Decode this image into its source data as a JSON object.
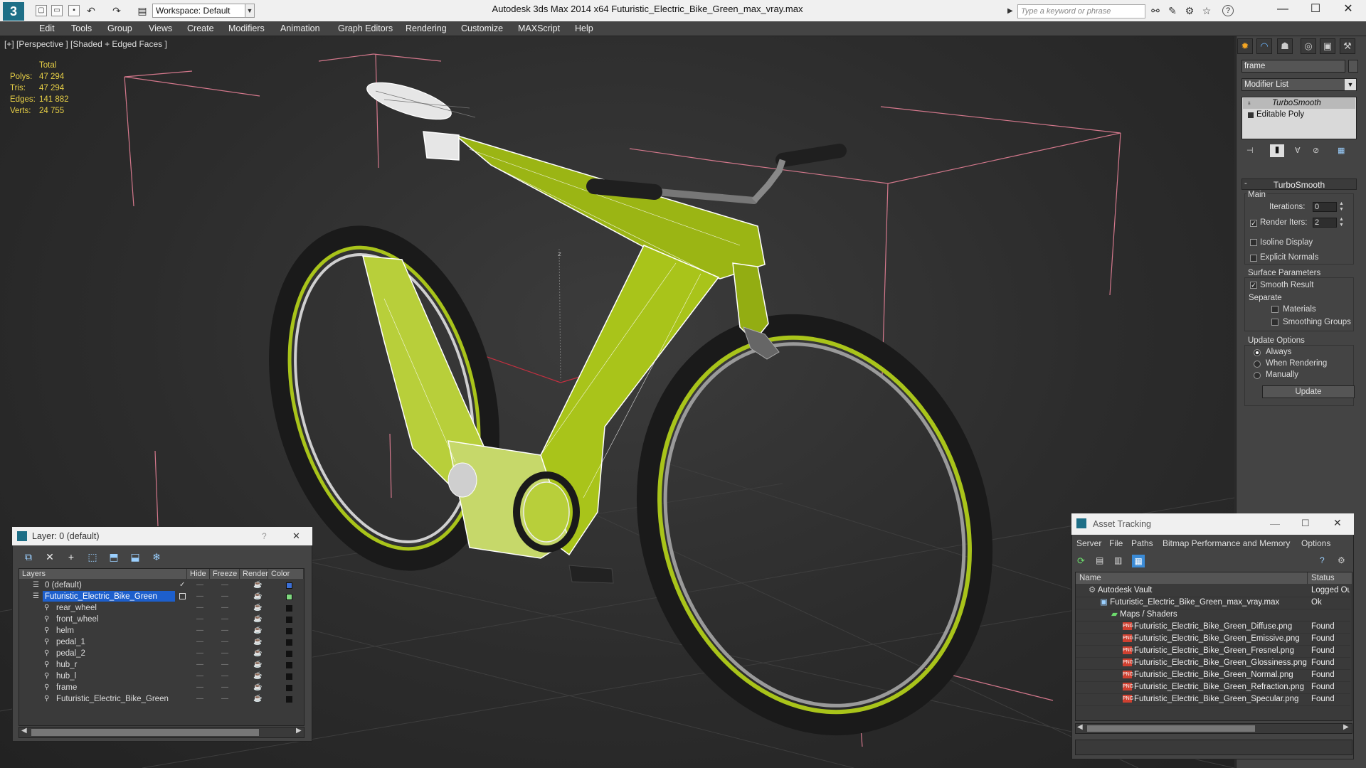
{
  "app": {
    "logo": "3",
    "workspace": "Workspace: Default",
    "title": "Autodesk 3ds Max  2014 x64        Futuristic_Electric_Bike_Green_max_vray.max",
    "search_placeholder": "Type a keyword or phrase"
  },
  "menus": [
    "Edit",
    "Tools",
    "Group",
    "Views",
    "Create",
    "Modifiers",
    "Animation",
    "Graph Editors",
    "Rendering",
    "Customize",
    "MAXScript",
    "Help"
  ],
  "viewport": {
    "label": "[+] [Perspective ] [Shaded + Edged Faces ]",
    "axis_label": "z",
    "stats": {
      "header": "Total",
      "rows": [
        {
          "label": "Polys:",
          "value": "47 294"
        },
        {
          "label": "Tris:",
          "value": "47 294"
        },
        {
          "label": "Edges:",
          "value": "141 882"
        },
        {
          "label": "Verts:",
          "value": "24 755"
        }
      ]
    }
  },
  "command_panel": {
    "object_name": "frame",
    "modifier_list": "Modifier List",
    "stack": [
      "TurboSmooth",
      "Editable Poly"
    ],
    "rollout_title": "TurboSmooth",
    "main_label": "Main",
    "iterations_label": "Iterations:",
    "iterations_value": "0",
    "render_iters_label": "Render Iters:",
    "render_iters_value": "2",
    "isoline_label": "Isoline Display",
    "explicit_normals_label": "Explicit Normals",
    "surface_params_label": "Surface Parameters",
    "smooth_result_label": "Smooth Result",
    "separate_label": "Separate",
    "materials_label": "Materials",
    "smoothing_groups_label": "Smoothing Groups",
    "update_options_label": "Update Options",
    "always_label": "Always",
    "when_rendering_label": "When Rendering",
    "manually_label": "Manually",
    "update_button": "Update"
  },
  "layer_dialog": {
    "title": "Layer: 0 (default)",
    "help": "?",
    "close": "✕",
    "columns": [
      "Layers",
      "Hide",
      "Freeze",
      "Render",
      "Color"
    ],
    "rows": [
      {
        "name": "0 (default)",
        "indent": 0,
        "selected": false,
        "color": "#3b6fd6"
      },
      {
        "name": "Futuristic_Electric_Bike_Green",
        "indent": 0,
        "selected": true,
        "color": "#7fd87f"
      },
      {
        "name": "rear_wheel",
        "indent": 1,
        "selected": false,
        "color": "#111111"
      },
      {
        "name": "front_wheel",
        "indent": 1,
        "selected": false,
        "color": "#111111"
      },
      {
        "name": "helm",
        "indent": 1,
        "selected": false,
        "color": "#111111"
      },
      {
        "name": "pedal_1",
        "indent": 1,
        "selected": false,
        "color": "#111111"
      },
      {
        "name": "pedal_2",
        "indent": 1,
        "selected": false,
        "color": "#111111"
      },
      {
        "name": "hub_r",
        "indent": 1,
        "selected": false,
        "color": "#111111"
      },
      {
        "name": "hub_l",
        "indent": 1,
        "selected": false,
        "color": "#111111"
      },
      {
        "name": "frame",
        "indent": 1,
        "selected": false,
        "color": "#111111"
      },
      {
        "name": "Futuristic_Electric_Bike_Green",
        "indent": 1,
        "selected": false,
        "color": "#111111"
      }
    ]
  },
  "asset_dialog": {
    "title": "Asset Tracking",
    "menus": [
      "Server",
      "File",
      "Paths",
      "Bitmap Performance and Memory",
      "Options"
    ],
    "col_name": "Name",
    "col_status": "Status",
    "rows": [
      {
        "name": "Autodesk Vault",
        "status": "Logged Ou",
        "indent": 0,
        "type": "vault"
      },
      {
        "name": "Futuristic_Electric_Bike_Green_max_vray.max",
        "status": "Ok",
        "indent": 1,
        "type": "max"
      },
      {
        "name": "Maps / Shaders",
        "status": "",
        "indent": 2,
        "type": "folder"
      },
      {
        "name": "Futuristic_Electric_Bike_Green_Diffuse.png",
        "status": "Found",
        "indent": 3,
        "type": "png"
      },
      {
        "name": "Futuristic_Electric_Bike_Green_Emissive.png",
        "status": "Found",
        "indent": 3,
        "type": "png"
      },
      {
        "name": "Futuristic_Electric_Bike_Green_Fresnel.png",
        "status": "Found",
        "indent": 3,
        "type": "png"
      },
      {
        "name": "Futuristic_Electric_Bike_Green_Glossiness.png",
        "status": "Found",
        "indent": 3,
        "type": "png"
      },
      {
        "name": "Futuristic_Electric_Bike_Green_Normal.png",
        "status": "Found",
        "indent": 3,
        "type": "png"
      },
      {
        "name": "Futuristic_Electric_Bike_Green_Refraction.png",
        "status": "Found",
        "indent": 3,
        "type": "png"
      },
      {
        "name": "Futuristic_Electric_Bike_Green_Specular.png",
        "status": "Found",
        "indent": 3,
        "type": "png"
      }
    ]
  },
  "colors": {
    "frame_green": "#a9c41a",
    "stat_yellow": "#e8d046",
    "bbox_pink": "#d4788c",
    "selection_blue": "#1d5fcc"
  }
}
